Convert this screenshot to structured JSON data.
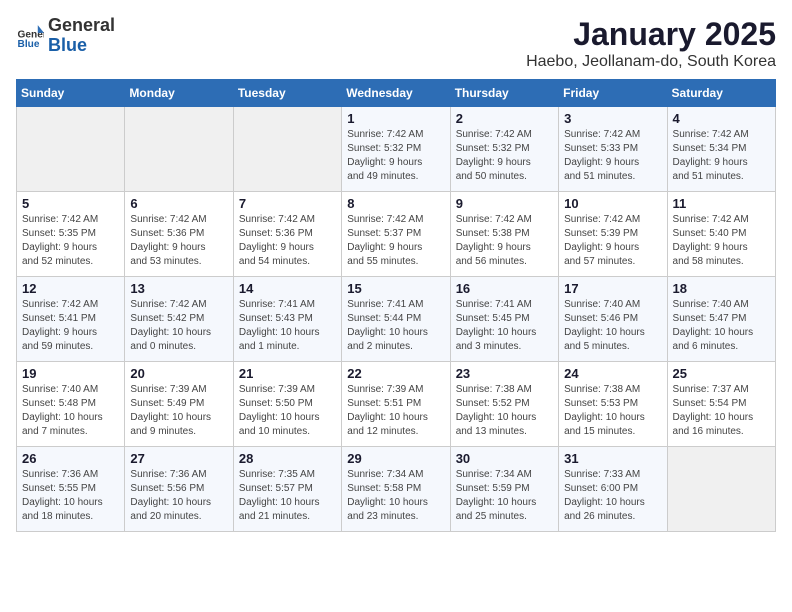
{
  "header": {
    "logo_general": "General",
    "logo_blue": "Blue",
    "title": "January 2025",
    "subtitle": "Haebo, Jeollanam-do, South Korea"
  },
  "weekdays": [
    "Sunday",
    "Monday",
    "Tuesday",
    "Wednesday",
    "Thursday",
    "Friday",
    "Saturday"
  ],
  "weeks": [
    [
      {
        "day": "",
        "info": ""
      },
      {
        "day": "",
        "info": ""
      },
      {
        "day": "",
        "info": ""
      },
      {
        "day": "1",
        "info": "Sunrise: 7:42 AM\nSunset: 5:32 PM\nDaylight: 9 hours\nand 49 minutes."
      },
      {
        "day": "2",
        "info": "Sunrise: 7:42 AM\nSunset: 5:32 PM\nDaylight: 9 hours\nand 50 minutes."
      },
      {
        "day": "3",
        "info": "Sunrise: 7:42 AM\nSunset: 5:33 PM\nDaylight: 9 hours\nand 51 minutes."
      },
      {
        "day": "4",
        "info": "Sunrise: 7:42 AM\nSunset: 5:34 PM\nDaylight: 9 hours\nand 51 minutes."
      }
    ],
    [
      {
        "day": "5",
        "info": "Sunrise: 7:42 AM\nSunset: 5:35 PM\nDaylight: 9 hours\nand 52 minutes."
      },
      {
        "day": "6",
        "info": "Sunrise: 7:42 AM\nSunset: 5:36 PM\nDaylight: 9 hours\nand 53 minutes."
      },
      {
        "day": "7",
        "info": "Sunrise: 7:42 AM\nSunset: 5:36 PM\nDaylight: 9 hours\nand 54 minutes."
      },
      {
        "day": "8",
        "info": "Sunrise: 7:42 AM\nSunset: 5:37 PM\nDaylight: 9 hours\nand 55 minutes."
      },
      {
        "day": "9",
        "info": "Sunrise: 7:42 AM\nSunset: 5:38 PM\nDaylight: 9 hours\nand 56 minutes."
      },
      {
        "day": "10",
        "info": "Sunrise: 7:42 AM\nSunset: 5:39 PM\nDaylight: 9 hours\nand 57 minutes."
      },
      {
        "day": "11",
        "info": "Sunrise: 7:42 AM\nSunset: 5:40 PM\nDaylight: 9 hours\nand 58 minutes."
      }
    ],
    [
      {
        "day": "12",
        "info": "Sunrise: 7:42 AM\nSunset: 5:41 PM\nDaylight: 9 hours\nand 59 minutes."
      },
      {
        "day": "13",
        "info": "Sunrise: 7:42 AM\nSunset: 5:42 PM\nDaylight: 10 hours\nand 0 minutes."
      },
      {
        "day": "14",
        "info": "Sunrise: 7:41 AM\nSunset: 5:43 PM\nDaylight: 10 hours\nand 1 minute."
      },
      {
        "day": "15",
        "info": "Sunrise: 7:41 AM\nSunset: 5:44 PM\nDaylight: 10 hours\nand 2 minutes."
      },
      {
        "day": "16",
        "info": "Sunrise: 7:41 AM\nSunset: 5:45 PM\nDaylight: 10 hours\nand 3 minutes."
      },
      {
        "day": "17",
        "info": "Sunrise: 7:40 AM\nSunset: 5:46 PM\nDaylight: 10 hours\nand 5 minutes."
      },
      {
        "day": "18",
        "info": "Sunrise: 7:40 AM\nSunset: 5:47 PM\nDaylight: 10 hours\nand 6 minutes."
      }
    ],
    [
      {
        "day": "19",
        "info": "Sunrise: 7:40 AM\nSunset: 5:48 PM\nDaylight: 10 hours\nand 7 minutes."
      },
      {
        "day": "20",
        "info": "Sunrise: 7:39 AM\nSunset: 5:49 PM\nDaylight: 10 hours\nand 9 minutes."
      },
      {
        "day": "21",
        "info": "Sunrise: 7:39 AM\nSunset: 5:50 PM\nDaylight: 10 hours\nand 10 minutes."
      },
      {
        "day": "22",
        "info": "Sunrise: 7:39 AM\nSunset: 5:51 PM\nDaylight: 10 hours\nand 12 minutes."
      },
      {
        "day": "23",
        "info": "Sunrise: 7:38 AM\nSunset: 5:52 PM\nDaylight: 10 hours\nand 13 minutes."
      },
      {
        "day": "24",
        "info": "Sunrise: 7:38 AM\nSunset: 5:53 PM\nDaylight: 10 hours\nand 15 minutes."
      },
      {
        "day": "25",
        "info": "Sunrise: 7:37 AM\nSunset: 5:54 PM\nDaylight: 10 hours\nand 16 minutes."
      }
    ],
    [
      {
        "day": "26",
        "info": "Sunrise: 7:36 AM\nSunset: 5:55 PM\nDaylight: 10 hours\nand 18 minutes."
      },
      {
        "day": "27",
        "info": "Sunrise: 7:36 AM\nSunset: 5:56 PM\nDaylight: 10 hours\nand 20 minutes."
      },
      {
        "day": "28",
        "info": "Sunrise: 7:35 AM\nSunset: 5:57 PM\nDaylight: 10 hours\nand 21 minutes."
      },
      {
        "day": "29",
        "info": "Sunrise: 7:34 AM\nSunset: 5:58 PM\nDaylight: 10 hours\nand 23 minutes."
      },
      {
        "day": "30",
        "info": "Sunrise: 7:34 AM\nSunset: 5:59 PM\nDaylight: 10 hours\nand 25 minutes."
      },
      {
        "day": "31",
        "info": "Sunrise: 7:33 AM\nSunset: 6:00 PM\nDaylight: 10 hours\nand 26 minutes."
      },
      {
        "day": "",
        "info": ""
      }
    ]
  ]
}
